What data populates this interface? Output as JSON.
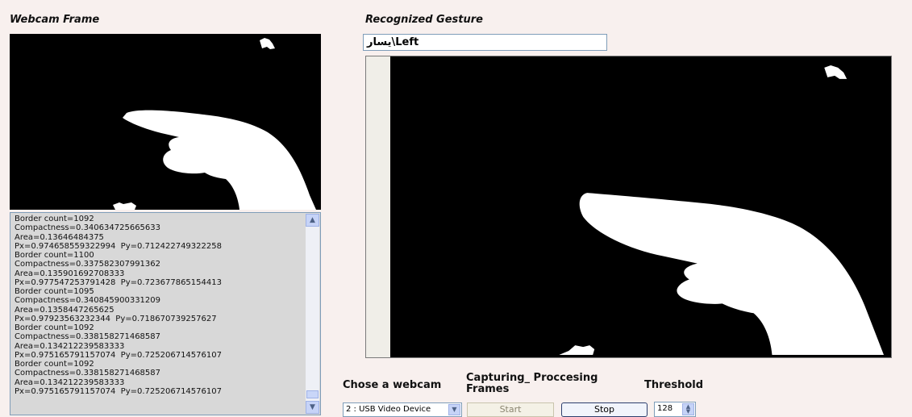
{
  "panels": {
    "webcam_title": "Webcam Frame",
    "gesture_title": "Recognized Gesture"
  },
  "gesture": {
    "value": "يسار\\Left"
  },
  "log": {
    "lines": [
      "Border count=1092",
      "Compactness=0.340634725665633",
      "Area=0.13646484375",
      "Px=0.974658559322994  Py=0.712422749322258",
      "Border count=1100",
      "Compactness=0.337582307991362",
      "Area=0.135901692708333",
      "Px=0.977547253791428  Py=0.723677865154413",
      "Border count=1095",
      "Compactness=0.340845900331209",
      "Area=0.1358447265625",
      "Px=0.97923563232344  Py=0.718670739257627",
      "Border count=1092",
      "Compactness=0.338158271468587",
      "Area=0.134212239583333",
      "Px=0.975165791157074  Py=0.725206714576107",
      "Border count=1092",
      "Compactness=0.338158271468587",
      "Area=0.134212239583333",
      "Px=0.975165791157074  Py=0.725206714576107"
    ]
  },
  "controls": {
    "chose_label": "Chose a webcam",
    "capture_label": "Capturing_ Proccesing Frames",
    "threshold_label": "Threshold",
    "webcam_selected": "2 : USB Video Device",
    "start_label": "Start",
    "stop_label": "Stop",
    "threshold_value": "128"
  },
  "icons": {
    "scroll_up": "chevron-up-icon",
    "scroll_down": "chevron-down-icon",
    "select_dropdown": "chevron-down-icon",
    "spinner": "updown-arrows-icon"
  },
  "colors": {
    "background": "#f8f0ee",
    "frame_background": "#000000",
    "mask_foreground": "#ffffff",
    "log_background": "#d8d8d8"
  }
}
